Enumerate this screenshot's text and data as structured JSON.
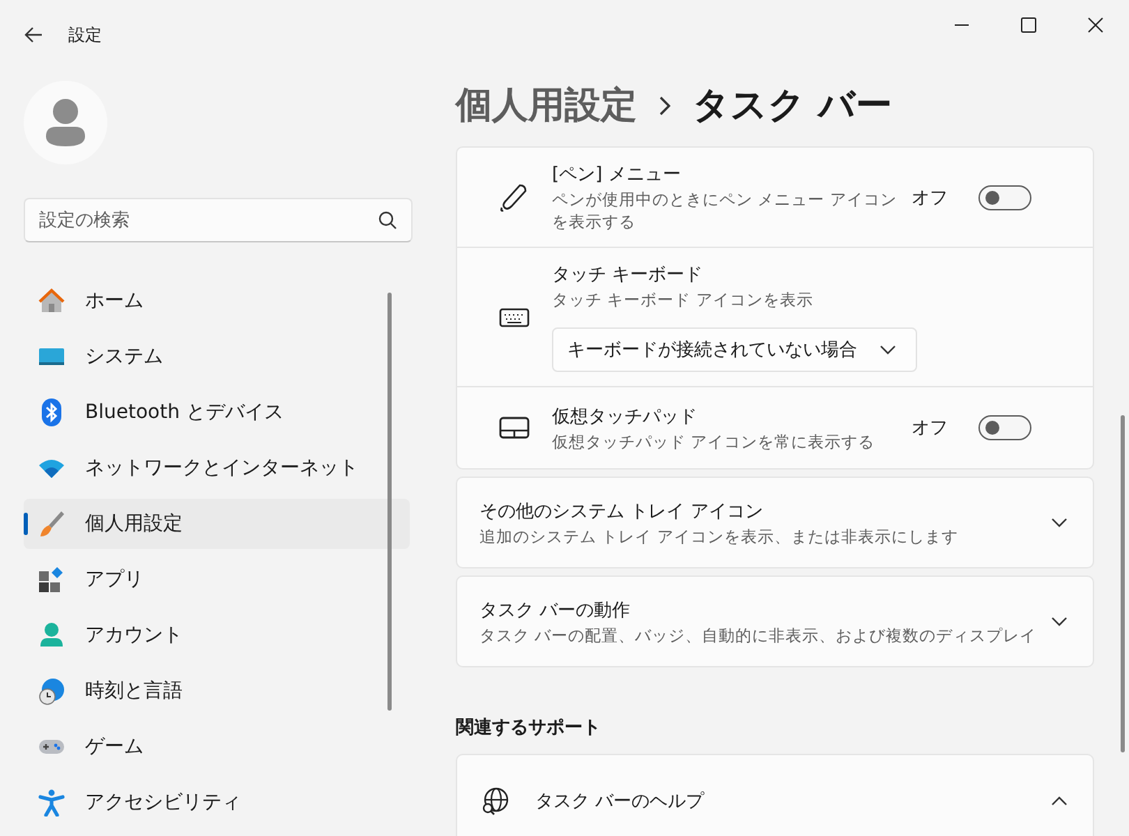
{
  "window": {
    "title": "設定"
  },
  "search": {
    "placeholder": "設定の検索"
  },
  "sidebar": {
    "items": [
      {
        "label": "ホーム",
        "selected": false
      },
      {
        "label": "システム",
        "selected": false
      },
      {
        "label": "Bluetooth とデバイス",
        "selected": false
      },
      {
        "label": "ネットワークとインターネット",
        "selected": false
      },
      {
        "label": "個人用設定",
        "selected": true
      },
      {
        "label": "アプリ",
        "selected": false
      },
      {
        "label": "アカウント",
        "selected": false
      },
      {
        "label": "時刻と言語",
        "selected": false
      },
      {
        "label": "ゲーム",
        "selected": false
      },
      {
        "label": "アクセシビリティ",
        "selected": false
      }
    ]
  },
  "breadcrumb": {
    "parent": "個人用設定",
    "current": "タスク バー"
  },
  "taskbar_icons_group": {
    "rows": [
      {
        "kind": "toggle",
        "title": "[ペン] メニュー",
        "description": "ペンが使用中のときにペン メニュー アイコンを表示する",
        "state_label": "オフ",
        "on": false
      },
      {
        "kind": "dropdown",
        "title": "タッチ キーボード",
        "description": "タッチ キーボード アイコンを表示",
        "value": "キーボードが接続されていない場合"
      },
      {
        "kind": "toggle",
        "title": "仮想タッチパッド",
        "description": "仮想タッチパッド アイコンを常に表示する",
        "state_label": "オフ",
        "on": false
      }
    ]
  },
  "expanders": [
    {
      "title": "その他のシステム トレイ アイコン",
      "description": "追加のシステム トレイ アイコンを表示、または非表示にします",
      "expanded": false
    },
    {
      "title": "タスク バーの動作",
      "description": "タスク バーの配置、バッジ、自動的に非表示、および複数のディスプレイ",
      "expanded": false
    }
  ],
  "related_support": {
    "heading": "関連するサポート",
    "items": [
      {
        "title": "タスク バーのヘルプ",
        "expanded": true
      }
    ]
  }
}
